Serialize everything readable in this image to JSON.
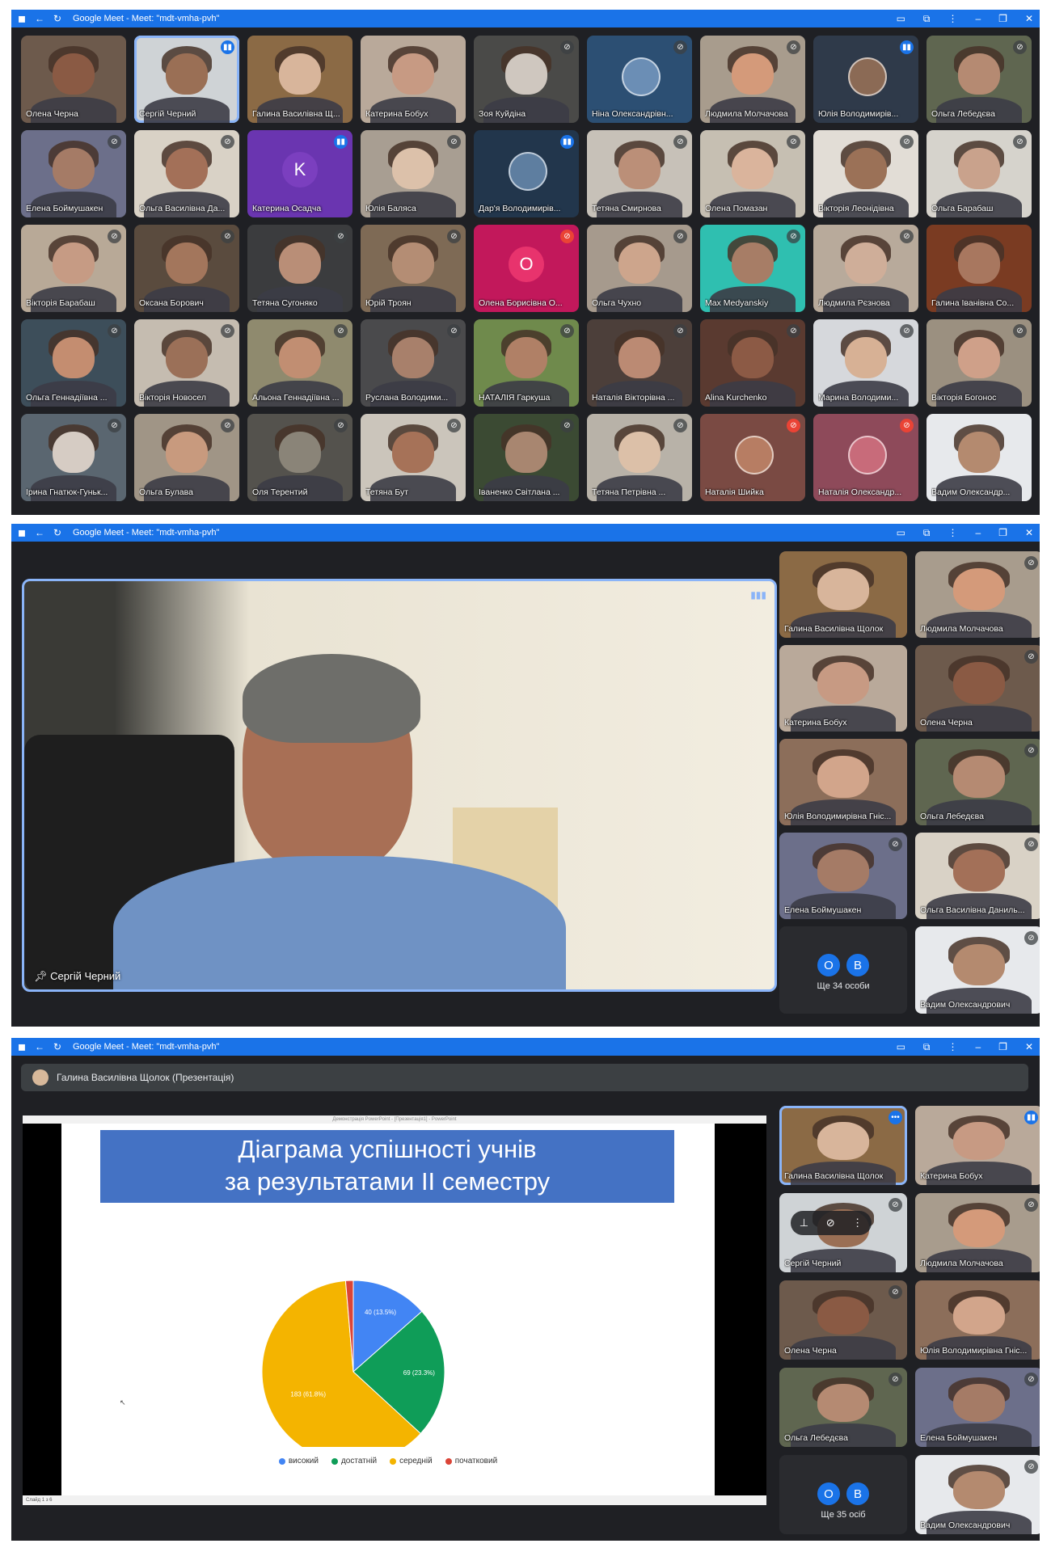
{
  "window": {
    "title": "Google Meet - Meet: \"mdt-vmha-pvh\"",
    "icons": [
      "meet-logo-icon",
      "back-arrow-icon",
      "reload-icon"
    ],
    "controls": [
      "camera-icon",
      "extension-icon",
      "more-vert-icon",
      "minimize-icon",
      "restore-icon",
      "close-icon"
    ]
  },
  "grid_view": {
    "participants": [
      {
        "name": "Олена Черна",
        "mic": "none",
        "tone": "#8a5a44",
        "bg": "#6d5a4c"
      },
      {
        "name": "Сергій Черний",
        "mic": "active",
        "tone": "#9a6f55",
        "bg": "#cfd3d6",
        "speaking": true
      },
      {
        "name": "Галина Василівна Щ...",
        "mic": "none",
        "tone": "#d8b59b",
        "bg": "#8b6a45"
      },
      {
        "name": "Катерина Бобух",
        "mic": "none",
        "tone": "#c79a83",
        "bg": "#b9a99a"
      },
      {
        "name": "Зоя Куйдіна",
        "mic": "muted",
        "tone": "#cfc7bf",
        "bg": "#4a4a48"
      },
      {
        "name": "Ніна Олександрівн...",
        "mic": "muted",
        "tone": "#6b8eb5",
        "bg": "#2c4f73",
        "avatar_image": true
      },
      {
        "name": "Людмила Молчачова",
        "mic": "muted",
        "tone": "#d49a7a",
        "bg": "#a89c8d"
      },
      {
        "name": "Юлія Володимирів...",
        "mic": "active",
        "tone": "#8b6a55",
        "bg": "#2f3a4a",
        "avatar_image": true
      },
      {
        "name": "Ольга Лебедєва",
        "mic": "muted",
        "tone": "#b58a72",
        "bg": "#5f6650"
      },
      {
        "name": "Елена Боймушакен",
        "mic": "muted",
        "tone": "#a57b66",
        "bg": "#6c6f8a"
      },
      {
        "name": "Ольга Василівна Да...",
        "mic": "muted",
        "tone": "#a37058",
        "bg": "#d9d2c6"
      },
      {
        "name": "Катерина Осадча",
        "mic": "active",
        "avatar_letter": "K",
        "avatar_color": "#7b3fbf",
        "bg": "#6a35b0"
      },
      {
        "name": "Юлія Баляса",
        "mic": "muted",
        "tone": "#dcc1aa",
        "bg": "#a89e92"
      },
      {
        "name": "Дар'я Володимирів...",
        "mic": "active",
        "tone": "#5e7ea0",
        "bg": "#22364c",
        "avatar_image": true
      },
      {
        "name": "Тетяна Смирнова",
        "mic": "muted",
        "tone": "#bb8f78",
        "bg": "#c7c1b8"
      },
      {
        "name": "Олена Помазан",
        "mic": "muted",
        "tone": "#dab49c",
        "bg": "#c6bfb2"
      },
      {
        "name": "Вікторія Леонідівна",
        "mic": "muted",
        "tone": "#9b7157",
        "bg": "#e2ddd6"
      },
      {
        "name": "Ольга Барабаш",
        "mic": "muted",
        "tone": "#c9a28c",
        "bg": "#d6d3cc"
      },
      {
        "name": "Вікторія Барабаш",
        "mic": "muted",
        "tone": "#c69b84",
        "bg": "#b8a997"
      },
      {
        "name": "Оксана Борович",
        "mic": "muted",
        "tone": "#a3765c",
        "bg": "#5a4b3e"
      },
      {
        "name": "Тетяна Сугоняко",
        "mic": "muted",
        "tone": "#b98e77",
        "bg": "#3b3c3e"
      },
      {
        "name": "Юрій Троян",
        "mic": "muted",
        "tone": "#b48d74",
        "bg": "#7e6a55"
      },
      {
        "name": "Олена Борисівна О...",
        "mic": "red",
        "avatar_letter": "O",
        "avatar_color": "#e8336d",
        "bg": "#c2185b"
      },
      {
        "name": "Ольга Чухно",
        "mic": "muted",
        "tone": "#cda58c",
        "bg": "#a69a8d"
      },
      {
        "name": "Max Medyanskiy",
        "mic": "muted",
        "tone": "#a77d66",
        "bg": "#2fbfb0"
      },
      {
        "name": "Людмила Рєзнова",
        "mic": "muted",
        "tone": "#cfae99",
        "bg": "#b8aa9b"
      },
      {
        "name": "Галина Іванівна Со...",
        "mic": "none",
        "tone": "#a8775f",
        "bg": "#7a3b22"
      },
      {
        "name": "Ольга Геннадіївна ...",
        "mic": "muted",
        "tone": "#c48d70",
        "bg": "#3d4e5a"
      },
      {
        "name": "Вікторія Новосел",
        "mic": "muted",
        "tone": "#9b7058",
        "bg": "#c5bcb0"
      },
      {
        "name": "Альона Геннадіївна ...",
        "mic": "muted",
        "tone": "#c18e72",
        "bg": "#8f8a6e"
      },
      {
        "name": "Руслана Володими...",
        "mic": "muted",
        "tone": "#a8806b",
        "bg": "#4a4a4c"
      },
      {
        "name": "НАТАЛІЯ Гаркуша",
        "mic": "muted",
        "tone": "#b08066",
        "bg": "#6f8a4c"
      },
      {
        "name": "Наталія Вікторівна ...",
        "mic": "muted",
        "tone": "#bb8a73",
        "bg": "#4c3f3a"
      },
      {
        "name": "Alina Kurchenko",
        "mic": "muted",
        "tone": "#8c5a45",
        "bg": "#5a3a30"
      },
      {
        "name": "Марина Володими...",
        "mic": "muted",
        "tone": "#d7b195",
        "bg": "#d6d8dc"
      },
      {
        "name": "Вікторія Богонос",
        "mic": "muted",
        "tone": "#cfa089",
        "bg": "#9b9080"
      },
      {
        "name": "Ірина Гнатюк-Гуньк...",
        "mic": "muted",
        "tone": "#d6ccc4",
        "bg": "#5a6670"
      },
      {
        "name": "Ольга Булава",
        "mic": "muted",
        "tone": "#c89a7e",
        "bg": "#a09586"
      },
      {
        "name": "Оля Терентий",
        "mic": "muted",
        "tone": "#8a8478",
        "bg": "#54524d"
      },
      {
        "name": "Тетяна Бут",
        "mic": "muted",
        "tone": "#a67258",
        "bg": "#cbc5bb"
      },
      {
        "name": "Іваненко Світлана ...",
        "mic": "muted",
        "tone": "#a88670",
        "bg": "#3b4a33"
      },
      {
        "name": "Тетяна Петрівна ...",
        "mic": "muted",
        "tone": "#dcc0a8",
        "bg": "#b8b2a8"
      },
      {
        "name": "Наталія Шийка",
        "mic": "red",
        "tone": "#b77d63",
        "bg": "#7a4a43",
        "avatar_image": true
      },
      {
        "name": "Наталія Олександр...",
        "mic": "red",
        "tone": "#c86b7a",
        "bg": "#8e4a5a",
        "avatar_image": true
      },
      {
        "name": "Вадим Олександр...",
        "mic": "none",
        "tone": "#b48a6f",
        "bg": "#e7e9ec"
      }
    ]
  },
  "speaker_view": {
    "main_speaker": "Сергій Черний",
    "side_tiles": [
      {
        "name": "Галина Василівна Щолок",
        "mic": "none",
        "tone": "#d8b59b",
        "bg": "#8b6a45"
      },
      {
        "name": "Людмила Молчачова",
        "mic": "muted",
        "tone": "#d49a7a",
        "bg": "#a89c8d"
      },
      {
        "name": "Катерина Бобух",
        "mic": "none",
        "tone": "#c79a83",
        "bg": "#b9a99a"
      },
      {
        "name": "Олена Черна",
        "mic": "muted",
        "tone": "#8a5a44",
        "bg": "#6d5a4c"
      },
      {
        "name": "Юлія Володимирівна Гніс...",
        "mic": "none",
        "tone": "#d2a58b",
        "bg": "#8c6e5a"
      },
      {
        "name": "Ольга Лебедєва",
        "mic": "muted",
        "tone": "#b58a72",
        "bg": "#5f6650"
      },
      {
        "name": "Елена Боймушакен",
        "mic": "muted",
        "tone": "#a57b66",
        "bg": "#6c6f8a"
      },
      {
        "name": "Ольга Василівна Даниль...",
        "mic": "muted",
        "tone": "#a37058",
        "bg": "#d9d2c6"
      }
    ],
    "more": {
      "initials": [
        "O",
        "B"
      ],
      "label": "Ще 34 особи"
    },
    "last_tile": {
      "name": "Вадим Олександрович",
      "mic": "muted",
      "tone": "#b48a6f",
      "bg": "#e7e9ec"
    }
  },
  "presentation_view": {
    "presenter_label": "Галина Василівна Щолок (Презентація)",
    "ppt_window_title": "Демонстрація PowerPoint - [Презентація1] - PowerPoint",
    "slide_counter": "Слайд 1 з 6",
    "slide_title_line1": "Діаграма успішності учнів",
    "slide_title_line2": "за результатами II семестру",
    "side_tiles": [
      {
        "name": "Галина Василівна Щолок",
        "mic": "more",
        "tone": "#d8b59b",
        "bg": "#8b6a45",
        "speaking": true
      },
      {
        "name": "Катерина Бобух",
        "mic": "active",
        "tone": "#c79a83",
        "bg": "#b9a99a"
      },
      {
        "name": "Сергій Черний",
        "mic": "muted",
        "tone": "#9a6f55",
        "bg": "#cfd3d6",
        "hover": true
      },
      {
        "name": "Людмила Молчачова",
        "mic": "muted",
        "tone": "#d49a7a",
        "bg": "#a89c8d"
      },
      {
        "name": "Олена Черна",
        "mic": "muted",
        "tone": "#8a5a44",
        "bg": "#6d5a4c"
      },
      {
        "name": "Юлія Володимирівна Гніс...",
        "mic": "none",
        "tone": "#d2a58b",
        "bg": "#8c6e5a"
      },
      {
        "name": "Ольга Лебедєва",
        "mic": "muted",
        "tone": "#b58a72",
        "bg": "#5f6650"
      },
      {
        "name": "Елена Боймушакен",
        "mic": "muted",
        "tone": "#a57b66",
        "bg": "#6c6f8a"
      }
    ],
    "more": {
      "initials": [
        "O",
        "B"
      ],
      "label": "Ще 35 осіб"
    },
    "last_tile": {
      "name": "Вадим Олександрович",
      "mic": "muted",
      "tone": "#b48a6f",
      "bg": "#e7e9ec"
    }
  },
  "chart_data": {
    "type": "pie",
    "title": "Діаграма успішності учнів за результатами II семестру",
    "categories": [
      "високий",
      "достатній",
      "середній",
      "початковий"
    ],
    "values": [
      40,
      69,
      183,
      4
    ],
    "data_labels": [
      "40 (13.5%)",
      "69 (23.3%)",
      "183 (61.8%)",
      ""
    ],
    "colors": [
      "#4285f4",
      "#0f9d58",
      "#f4b400",
      "#db4437"
    ],
    "legend": "bottom"
  }
}
